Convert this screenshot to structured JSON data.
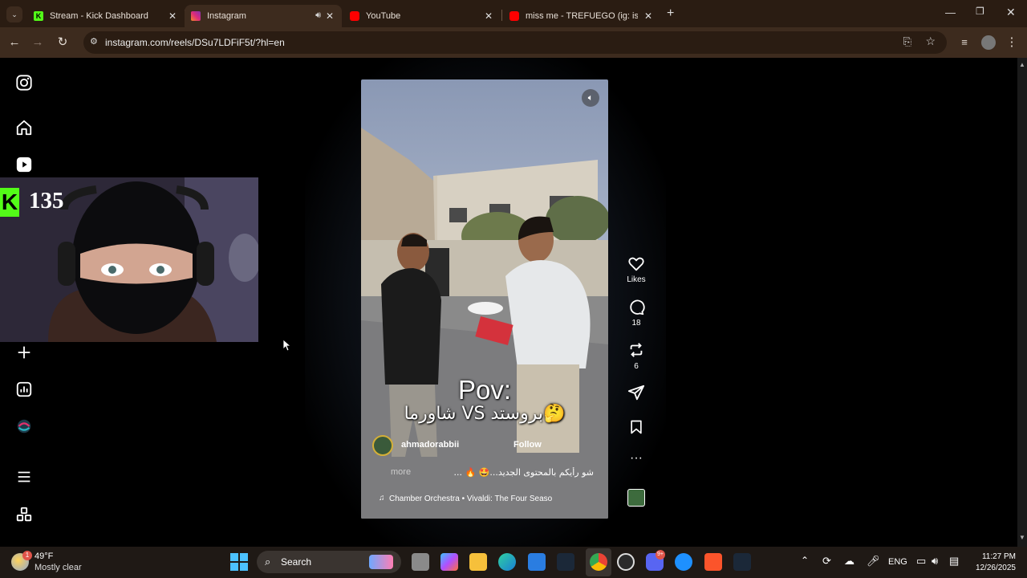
{
  "browser": {
    "tabs": [
      {
        "title": "Stream - Kick Dashboard",
        "icon": "kick-icon",
        "color": "#53fc18"
      },
      {
        "title": "Instagram",
        "icon": "instagram-icon",
        "color": "#e1306c",
        "audio": true
      },
      {
        "title": "YouTube",
        "icon": "youtube-icon",
        "color": "#ff0000"
      },
      {
        "title": "miss me - TREFUEGO (ig: ismok",
        "icon": "youtube-icon",
        "color": "#ff0000"
      }
    ],
    "url": "instagram.com/reels/DSu7LDFiF5t/?hl=en"
  },
  "overlay": {
    "kick_viewers": "135"
  },
  "reel": {
    "caption_title": "Pov:",
    "caption_arabic": "شاورما VS بروستد🤔",
    "username": "ahmadorabbii",
    "follow_label": "Follow",
    "description": "شو رأيكم بالمحتوى الجديد...🤩 🔥 ...",
    "more_label": "more",
    "audio": "Chamber Orchestra • Vivaldi: The Four Seaso"
  },
  "actions": {
    "likes_label": "Likes",
    "comments_count": "18",
    "reposts_count": "6"
  },
  "taskbar": {
    "weather_temp": "49°F",
    "weather_desc": "Mostly clear",
    "weather_badge": "1",
    "search_label": "Search",
    "lang": "ENG",
    "time": "11:27 PM",
    "date": "12/26/2025",
    "discord_badge": "9+"
  }
}
